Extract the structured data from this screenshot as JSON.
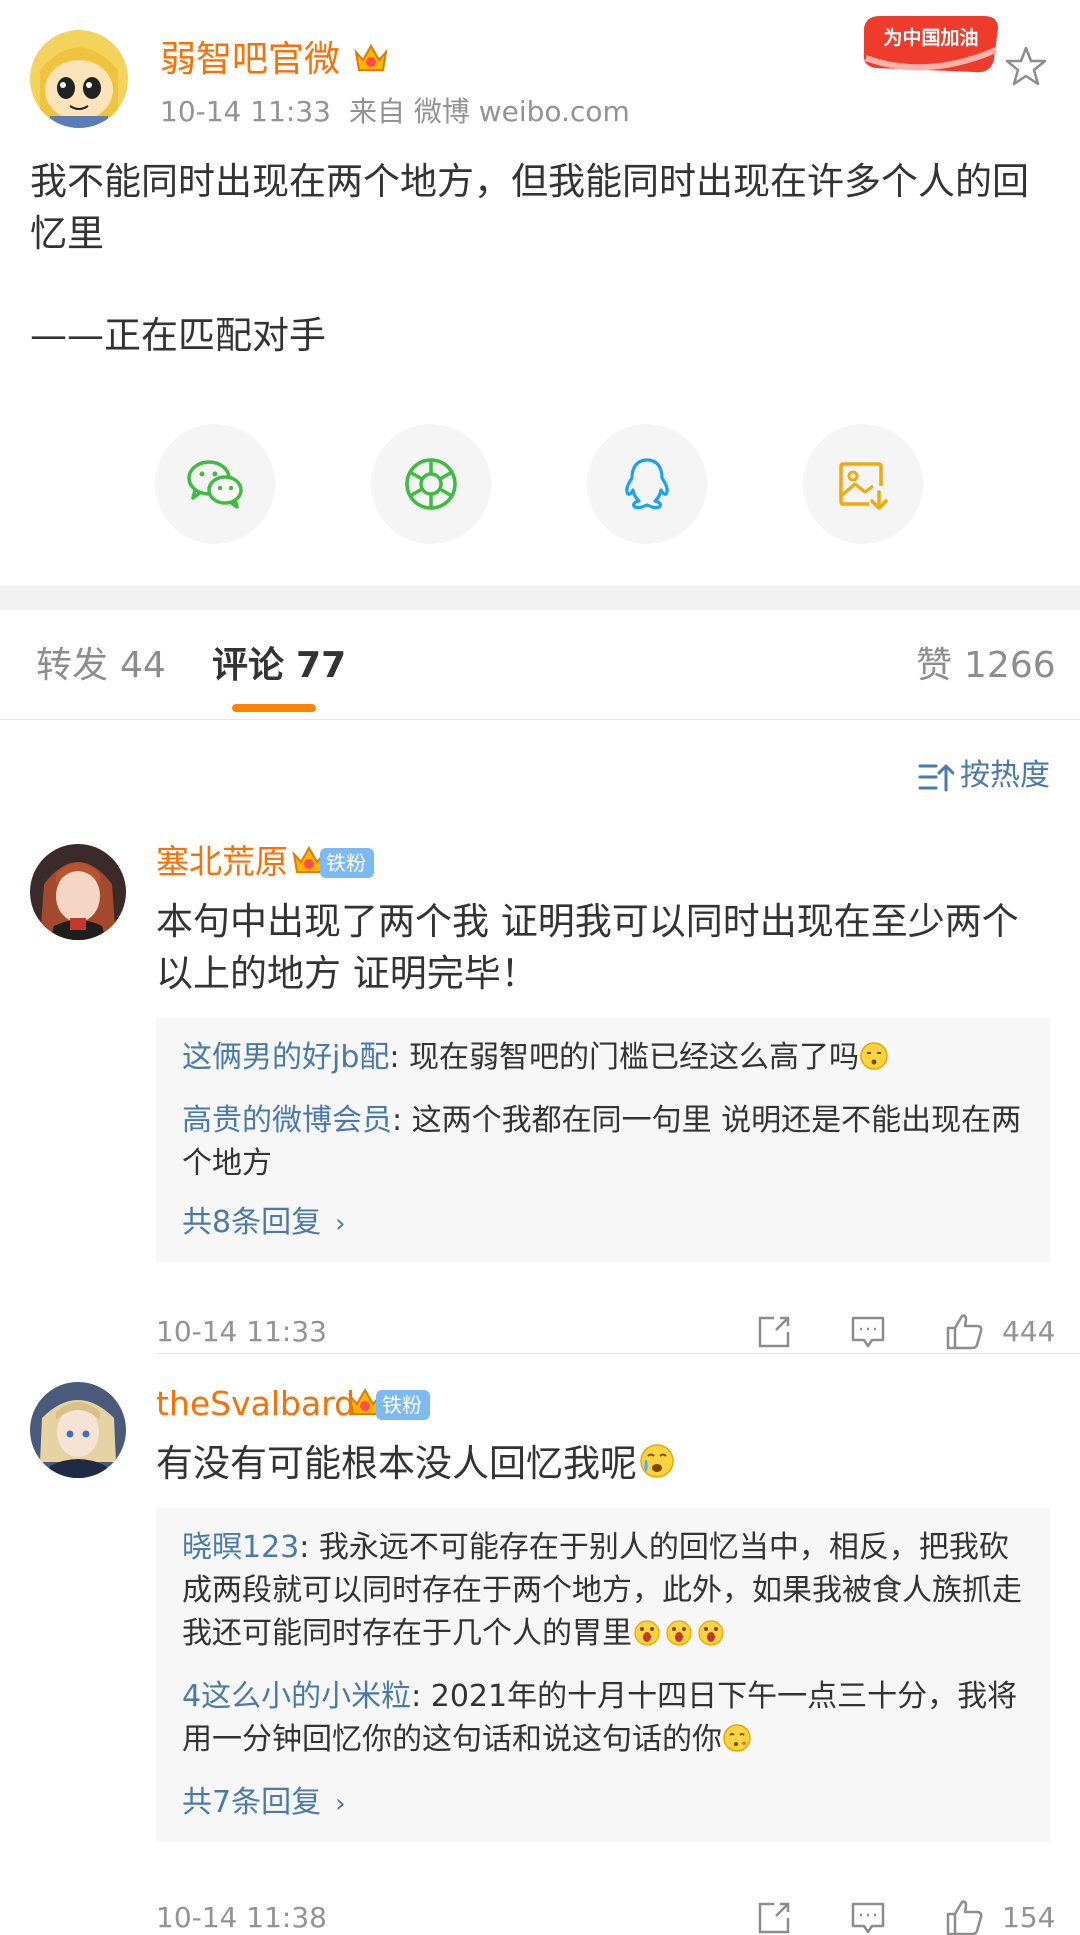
{
  "post": {
    "author": "弱智吧官微",
    "time": "10-14 11:33",
    "source": "来自 微博 weibo.com",
    "campaign_badge": "为中国加油",
    "text": "我不能同时出现在两个地方，但我能同时出现在许多个人的回忆里",
    "signature": "——正在匹配对手"
  },
  "share": {
    "items": [
      {
        "icon": "wechat-icon",
        "color": "#3ebc3f"
      },
      {
        "icon": "moments-icon",
        "color": "#3ebc3f"
      },
      {
        "icon": "qq-icon",
        "color": "#1aa3f0"
      },
      {
        "icon": "save-image-icon",
        "color": "#f2a90d"
      }
    ]
  },
  "tabs": [
    {
      "label": "转发",
      "count": "44"
    },
    {
      "label": "评论",
      "count": "77"
    },
    {
      "label": "赞",
      "count": "1266"
    }
  ],
  "sort_label": "按热度",
  "comments": [
    {
      "user": "塞北荒原",
      "fan_badge": "铁粉",
      "text": "本句中出现了两个我 证明我可以同时出现在至少两个以上的地方 证明完毕！",
      "replies": [
        {
          "user": "这俩男的好jb配",
          "text": ": 现在弱智吧的门槛已经这么高了吗"
        },
        {
          "user": "高贵的微博会员",
          "text": ": 这两个我都在同一句里 说明还是不能出现在两个地方"
        }
      ],
      "more_replies": "共8条回复",
      "time": "10-14 11:33",
      "likes": "444"
    },
    {
      "user": "theSvalbard",
      "fan_badge": "铁粉",
      "text": "有没有可能根本没人回忆我呢",
      "replies": [
        {
          "user": "晓暝123",
          "text": ": 我永远不可能存在于别人的回忆当中，相反，把我砍成两段就可以同时存在于两个地方，此外，如果我被食人族抓走我还可能同时存在于几个人的胃里"
        },
        {
          "user": "4这么小的小米粒",
          "text": ": 2021年的十月十四日下午一点三十分，我将用一分钟回忆你的这句话和说这句话的你"
        }
      ],
      "more_replies": "共7条回复",
      "time": "10-14 11:38",
      "likes": "154"
    }
  ],
  "colors": {
    "accent": "#ff8200",
    "username": "#ff6e00",
    "link": "#4a7aaa",
    "meta": "#939393"
  }
}
